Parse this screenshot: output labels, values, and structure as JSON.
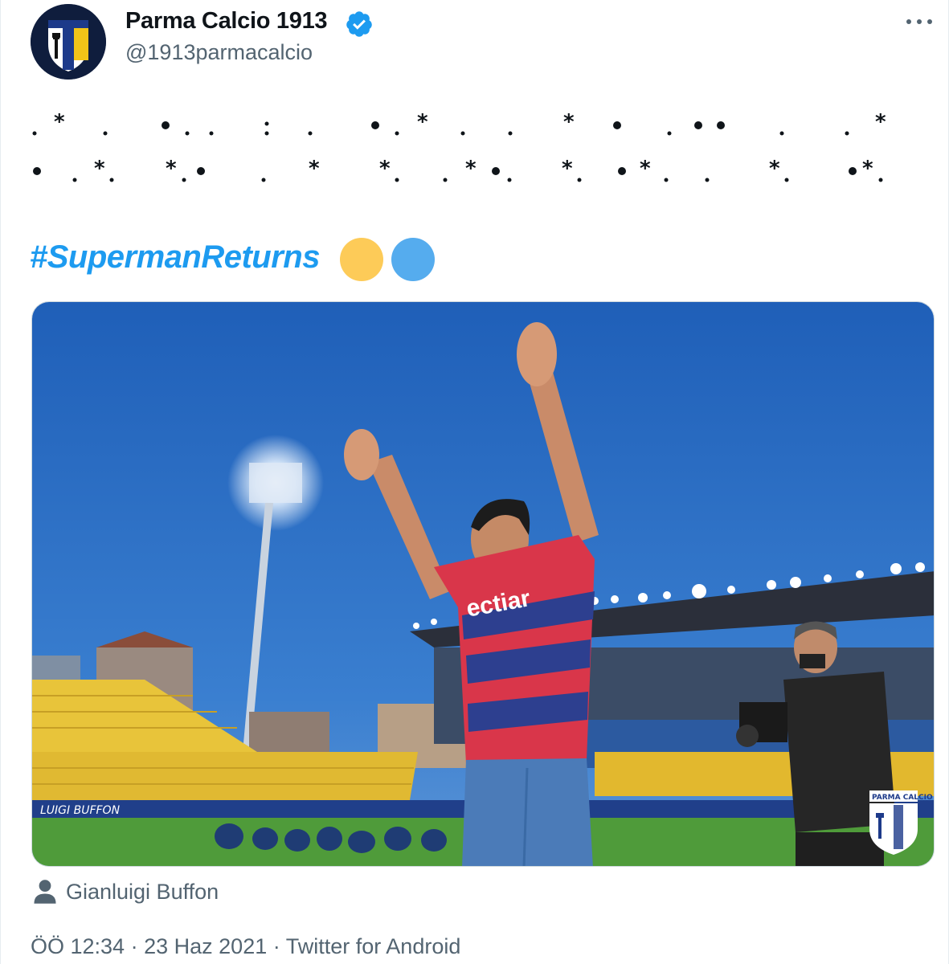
{
  "tweet": {
    "author": {
      "name": "Parma Calcio 1913",
      "handle": "@1913parmacalcio",
      "verified": true
    },
    "hashtag": "#SupermanReturns",
    "emoji": [
      "yellow-heart",
      "blue-heart"
    ],
    "media": {
      "alt": "Gianluigi Buffon waving to the stadium",
      "watermark": "PARMA CALCIO"
    },
    "tagged_person": "Gianluigi Buffon",
    "time": "ÖÖ 12:34",
    "separator": "·",
    "date": "23 Haz 2021",
    "source": "Twitter for Android"
  },
  "colors": {
    "link": "#1d9bf0",
    "secondary": "#536471",
    "verified": "#1d9bf0",
    "sky": "#2f6fc2",
    "grass": "#4f9b3a",
    "seats": "#e8c43a"
  },
  "icons": [
    "parma-crest-icon",
    "verified-badge-icon",
    "more-options-icon",
    "person-icon"
  ]
}
